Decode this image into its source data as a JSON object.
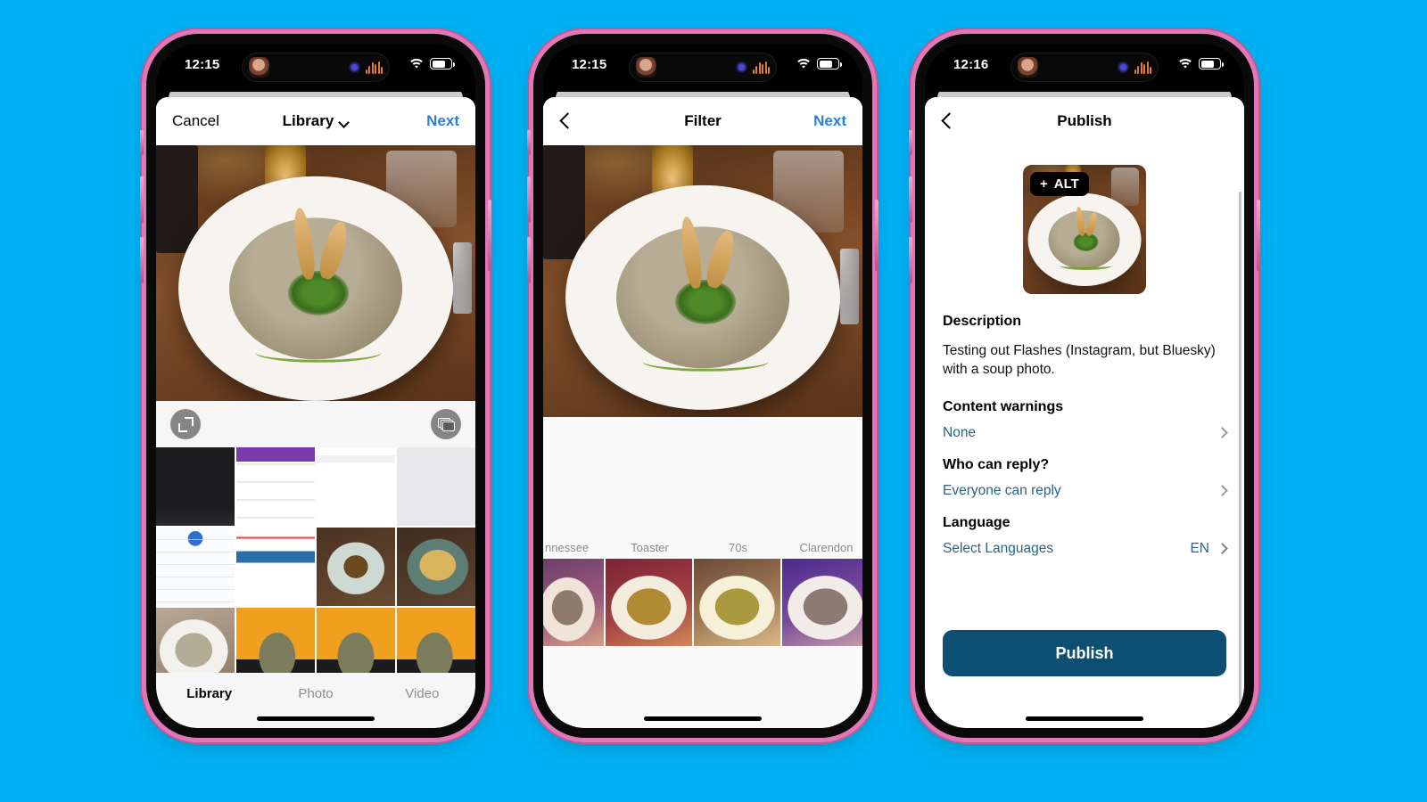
{
  "background_color": "#00b2f5",
  "frame_color": "#e078b8",
  "accent_blue": "#2a7fe0",
  "link_color": "#2a6384",
  "publish_button_color": "#0d4f72",
  "phones": [
    {
      "id": "phone-library",
      "status_bar": {
        "time": "12:15",
        "wifi": "wifi-icon",
        "battery": "battery-icon"
      },
      "nav": {
        "left_label": "Cancel",
        "title": "Library",
        "title_caret": "chevron-down-icon",
        "right_label": "Next"
      },
      "toolbar": {
        "expand_icon": "expand-icon",
        "multi_select_icon": "stack-layers-icon"
      },
      "tabs": [
        {
          "label": "Library",
          "active": true
        },
        {
          "label": "Photo",
          "active": false
        },
        {
          "label": "Video",
          "active": false
        }
      ]
    },
    {
      "id": "phone-filter",
      "status_bar": {
        "time": "12:15",
        "wifi": "wifi-icon",
        "battery": "battery-icon"
      },
      "nav": {
        "back_icon": "chevron-left-icon",
        "title": "Filter",
        "right_label": "Next"
      },
      "filters": [
        {
          "label": "nnessee"
        },
        {
          "label": "Toaster"
        },
        {
          "label": "70s"
        },
        {
          "label": "Clarendon"
        },
        {
          "label": ""
        }
      ]
    },
    {
      "id": "phone-publish",
      "status_bar": {
        "time": "12:16",
        "wifi": "wifi-icon",
        "battery": "battery-icon"
      },
      "nav": {
        "back_icon": "chevron-left-icon",
        "title": "Publish"
      },
      "alt_badge": {
        "plus": "+",
        "label": "ALT"
      },
      "sections": {
        "description_title": "Description",
        "description_text": "Testing out Flashes (Instagram, but Bluesky) with a soup photo.",
        "content_warnings_title": "Content warnings",
        "content_warnings_value": "None",
        "who_can_reply_title": "Who can reply?",
        "who_can_reply_value": "Everyone can reply",
        "language_title": "Language",
        "language_value": "Select Languages",
        "language_code": "EN"
      },
      "publish_button_label": "Publish"
    }
  ]
}
